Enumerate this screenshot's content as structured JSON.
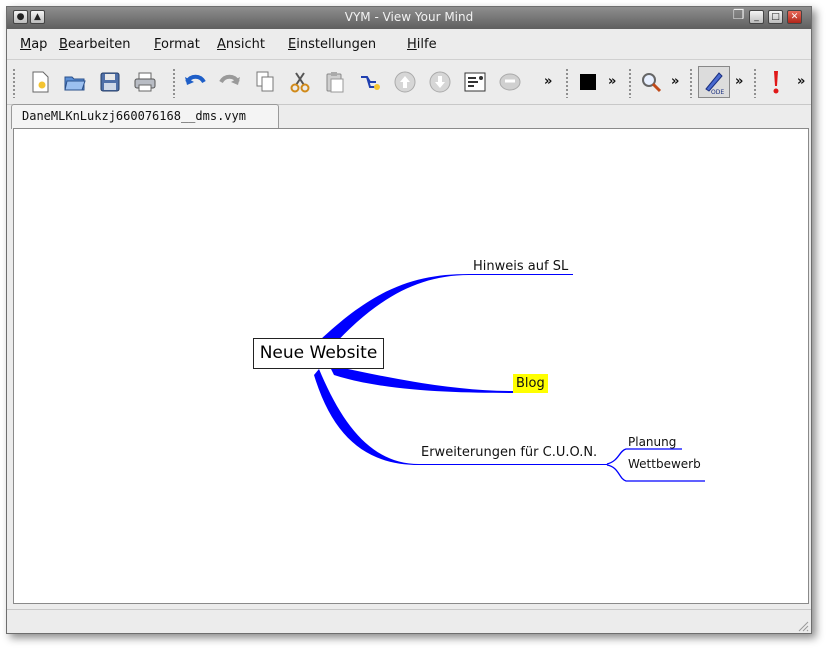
{
  "window": {
    "title": "VYM - View Your Mind"
  },
  "menu": {
    "items": [
      {
        "label": "Map",
        "u": "M",
        "rest": "ap"
      },
      {
        "label": "Bearbeiten",
        "u": "B",
        "rest": "earbeiten"
      },
      {
        "label": "Format",
        "u": "F",
        "rest": "ormat"
      },
      {
        "label": "Ansicht",
        "u": "A",
        "rest": "nsicht"
      },
      {
        "label": "Einstellungen",
        "u": "E",
        "rest": "instellungen"
      },
      {
        "label": "Hilfe",
        "u": "H",
        "rest": "ilfe"
      }
    ]
  },
  "toolbar": {
    "icons": [
      "new-file-icon",
      "open-folder-icon",
      "save-icon",
      "print-icon",
      "undo-icon",
      "redo-icon",
      "copy-icon",
      "cut-icon",
      "paste-icon",
      "add-branch-icon",
      "move-up-icon",
      "move-down-icon",
      "sort-icon",
      "toggle-scroll-icon",
      "color-square-icon",
      "find-icon",
      "format-painter-icon",
      "important-flag-icon"
    ],
    "overflow": "»",
    "accent": "#0000ff"
  },
  "tab": {
    "label": "DaneMLKnLukzj660076168__dms.vym"
  },
  "map": {
    "root": "Neue Website",
    "branches": [
      {
        "label": "Hinweis auf SL"
      },
      {
        "label": "Blog",
        "highlight": "#ffff00"
      },
      {
        "label": "Erweiterungen für C.U.O.N.",
        "children": [
          "Planung",
          "Wettbewerb"
        ]
      }
    ],
    "link_color": "#0000ff"
  }
}
